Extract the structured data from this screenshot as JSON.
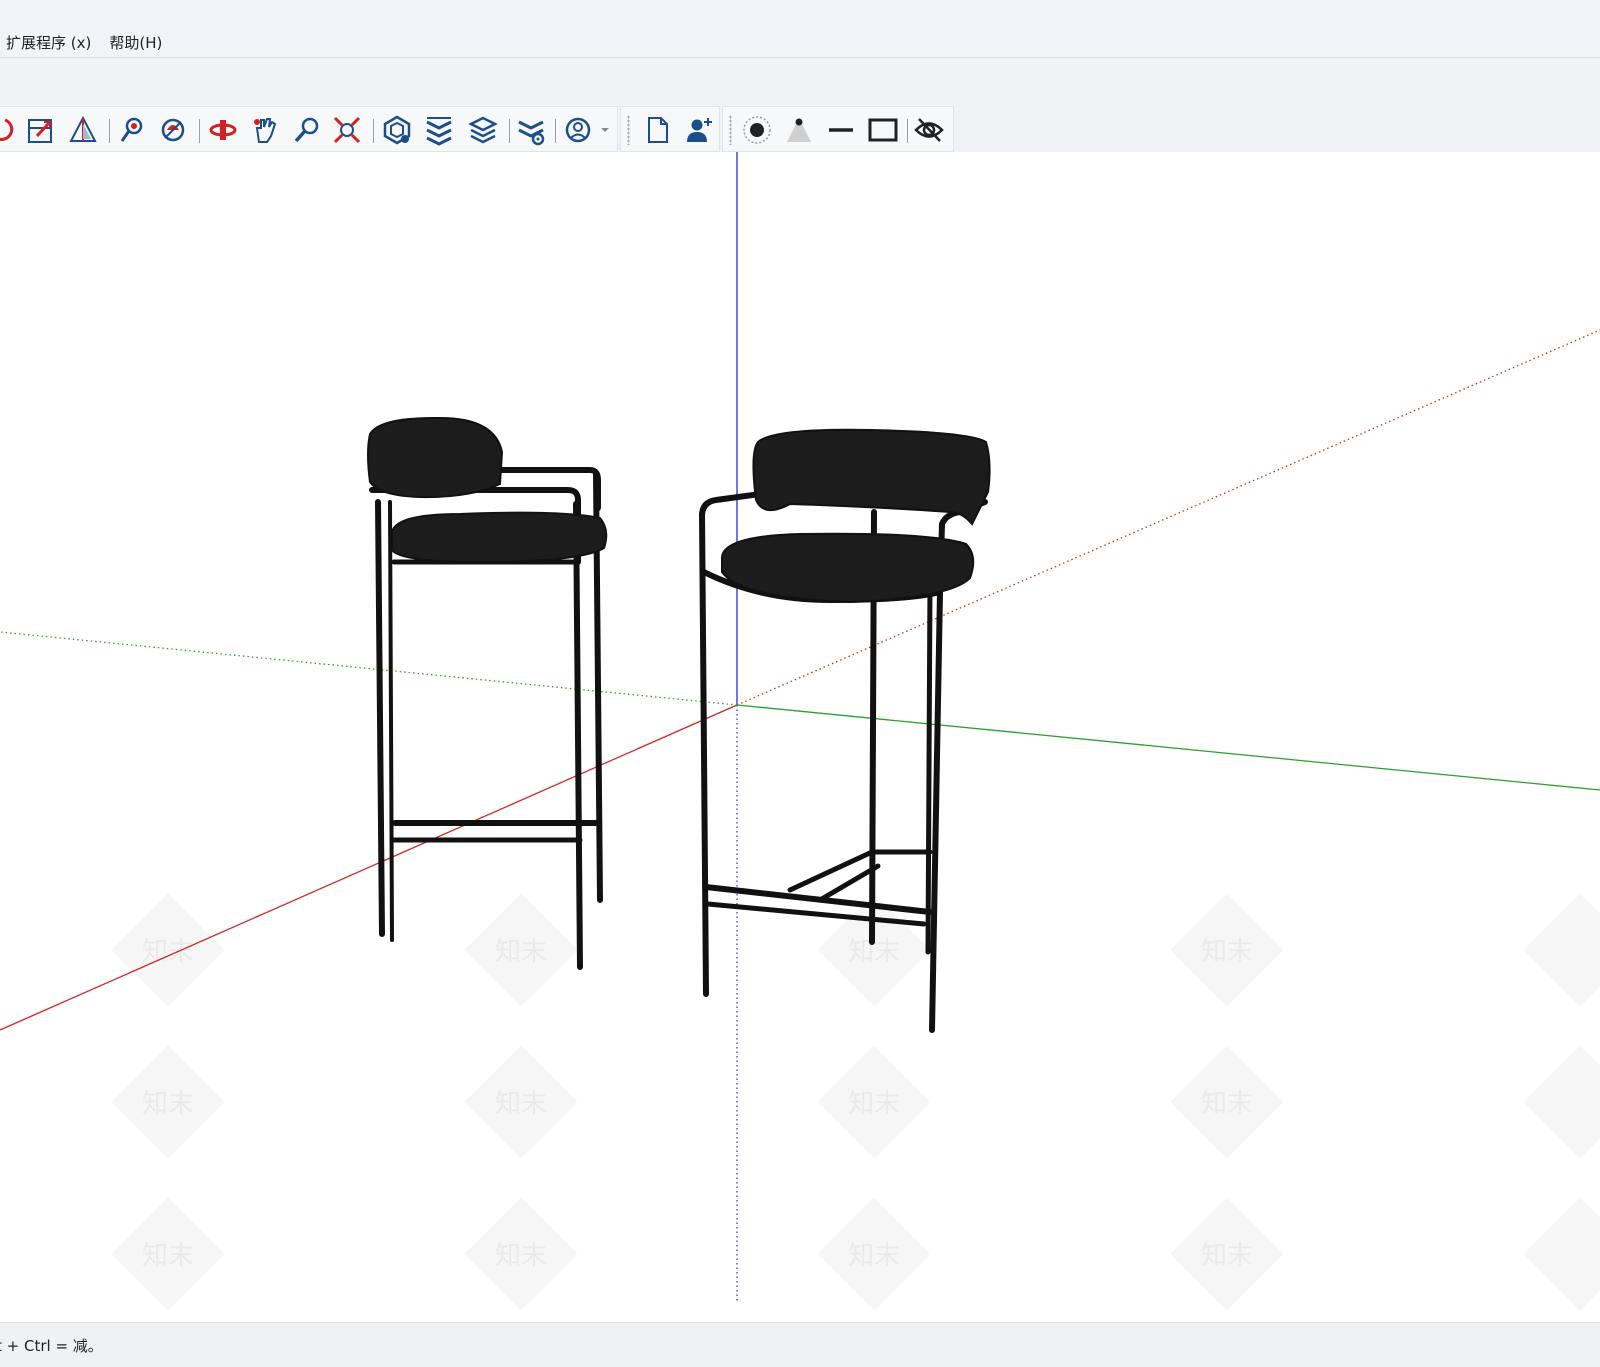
{
  "menu": {
    "items": [
      {
        "label": "扩展程序 (x)"
      },
      {
        "label": "帮助(H)"
      }
    ]
  },
  "toolbar": {
    "groups": [
      {
        "name": "view-tools",
        "icons": [
          "orbit-icon",
          "zoom-window-icon",
          "section-plane-icon",
          "position-camera-icon",
          "look-around-icon",
          "walk-icon",
          "pan-hand-icon",
          "zoom-icon",
          "zoom-extents-icon",
          "outer-shell-icon",
          "solid-tools-icon",
          "layers-icon",
          "solid-settings-icon",
          "profile-dropdown-icon"
        ]
      },
      {
        "name": "model-tools",
        "icons": [
          "new-file-icon",
          "add-user-icon"
        ]
      },
      {
        "name": "style-tools",
        "icons": [
          "point-display-icon",
          "cone-display-icon",
          "line-display-icon",
          "rectangle-display-icon",
          "hide-view-icon"
        ]
      }
    ]
  },
  "watermark": {
    "text": "知末"
  },
  "status": {
    "text": "t + Ctrl = 减。"
  },
  "colors": {
    "axis_red": "#cc2a2a",
    "axis_green": "#2aa02a",
    "axis_blue": "#2a2acc",
    "icon_blue": "#1a4f8c",
    "icon_red": "#d42020",
    "chair": "#1a1a1a"
  }
}
